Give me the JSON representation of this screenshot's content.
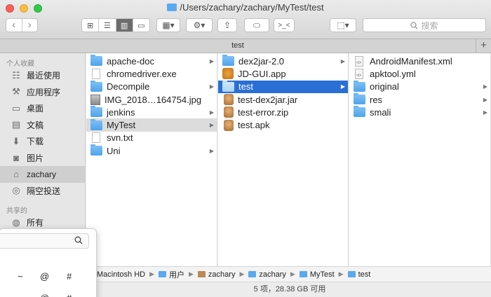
{
  "window": {
    "title": "/Users/zachary/zachary/MyTest/test"
  },
  "toolbar": {
    "back": "‹",
    "forward": "›",
    "view_icons": [
      "⊞",
      "☰",
      "▥",
      "▭"
    ],
    "group_icon": "▦▾",
    "action_icon": "⚙▾",
    "share_icon": "⇪",
    "tag_icon": "⬭",
    "terminal_icon": ">_<",
    "dropbox_icon": "⬚▾",
    "search_placeholder": "搜索",
    "search_icon": "search-icon"
  },
  "tabs": {
    "current": "test",
    "add": "+"
  },
  "sidebar": {
    "favorites_header": "个人收藏",
    "items": [
      {
        "label": "最近使用",
        "icon": "clock-icon",
        "glyph": "☷"
      },
      {
        "label": "应用程序",
        "icon": "apps-icon",
        "glyph": "⚒"
      },
      {
        "label": "桌面",
        "icon": "desktop-icon",
        "glyph": "▭"
      },
      {
        "label": "文稿",
        "icon": "documents-icon",
        "glyph": "▤"
      },
      {
        "label": "下载",
        "icon": "download-icon",
        "glyph": "⬇"
      },
      {
        "label": "图片",
        "icon": "camera-icon",
        "glyph": "◙"
      },
      {
        "label": "zachary",
        "icon": "home-icon",
        "glyph": "⌂"
      },
      {
        "label": "隔空投送",
        "icon": "airdrop-icon",
        "glyph": "◎"
      }
    ],
    "shared_header": "共享的",
    "shared_items": [
      {
        "label": "所有",
        "icon": "network-icon",
        "glyph": "◍"
      }
    ]
  },
  "columns": {
    "col1": [
      {
        "name": "apache-doc",
        "type": "folder",
        "arrow": true
      },
      {
        "name": "chromedriver.exe",
        "type": "doc",
        "arrow": false
      },
      {
        "name": "Decompile",
        "type": "folder",
        "arrow": true
      },
      {
        "name": "IMG_2018…164754.jpg",
        "type": "image",
        "arrow": false
      },
      {
        "name": "jenkins",
        "type": "folder",
        "arrow": true
      },
      {
        "name": "MyTest",
        "type": "folder",
        "arrow": true,
        "selected": "gray"
      },
      {
        "name": "svn.txt",
        "type": "doc",
        "arrow": false
      },
      {
        "name": "Uni",
        "type": "folder",
        "arrow": true
      }
    ],
    "col2": [
      {
        "name": "dex2jar-2.0",
        "type": "folder",
        "arrow": true
      },
      {
        "name": "JD-GUI.app",
        "type": "app",
        "arrow": false
      },
      {
        "name": "test",
        "type": "folder",
        "arrow": true,
        "selected": "blue"
      },
      {
        "name": "test-dex2jar.jar",
        "type": "jar",
        "arrow": false
      },
      {
        "name": "test-error.zip",
        "type": "jar",
        "arrow": false
      },
      {
        "name": "test.apk",
        "type": "jar",
        "arrow": false
      }
    ],
    "col3": [
      {
        "name": "AndroidManifest.xml",
        "type": "xml",
        "arrow": false
      },
      {
        "name": "apktool.yml",
        "type": "xml",
        "arrow": false
      },
      {
        "name": "original",
        "type": "folder",
        "arrow": true
      },
      {
        "name": "res",
        "type": "folder",
        "arrow": true
      },
      {
        "name": "smali",
        "type": "folder",
        "arrow": true
      }
    ]
  },
  "pathbar": [
    {
      "label": "Macintosh HD",
      "icon": "none"
    },
    {
      "label": "用户",
      "icon": "folder"
    },
    {
      "label": "zachary",
      "icon": "home"
    },
    {
      "label": "zachary",
      "icon": "folder"
    },
    {
      "label": "MyTest",
      "icon": "folder"
    },
    {
      "label": "test",
      "icon": "folder"
    }
  ],
  "status": {
    "text": "5 项，28.38 GB 可用"
  },
  "popover": {
    "symbols": [
      "~",
      "@",
      "#",
      "~",
      "@",
      "#"
    ],
    "search_icon": "search-icon"
  }
}
